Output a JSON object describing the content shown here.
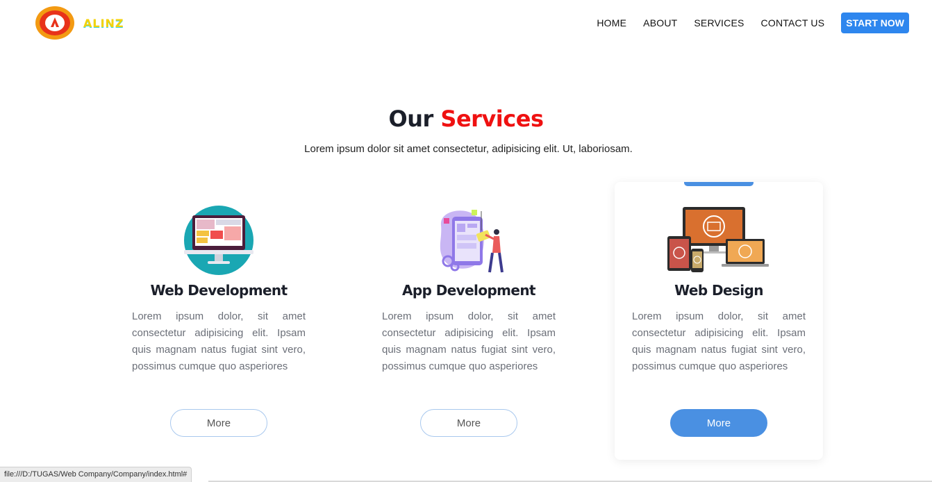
{
  "brand": {
    "name": "ALINZ"
  },
  "nav": {
    "links": [
      "HOME",
      "ABOUT",
      "SERVICES",
      "CONTACT US"
    ],
    "cta": "START NOW"
  },
  "section": {
    "title_dark": "Our",
    "title_red": "Services",
    "subtitle": "Lorem ipsum dolor sit amet consectetur, adipisicing elit. Ut, laboriosam."
  },
  "cards": [
    {
      "title": "Web Development",
      "text": "Lorem ipsum dolor, sit amet consectetur adipisicing elit. Ipsam quis magnam natus fugiat sint vero, possimus cumque quo asperiores",
      "button": "More",
      "icon": "web-development-illustration"
    },
    {
      "title": "App Development",
      "text": "Lorem ipsum dolor, sit amet consectetur adipisicing elit. Ipsam quis magnam natus fugiat sint vero, possimus cumque quo asperiores",
      "button": "More",
      "icon": "app-development-illustration"
    },
    {
      "title": "Web Design",
      "text": "Lorem ipsum dolor, sit amet consectetur adipisicing elit. Ipsam quis magnam natus fugiat sint vero, possimus cumque quo asperiores",
      "button": "More",
      "icon": "web-design-devices-illustration",
      "active": true
    }
  ],
  "status": {
    "url": "file:///D:/TUGAS/Web Company/Company/index.html#"
  },
  "colors": {
    "accent": "#4a90e2",
    "cta": "#2e86ee",
    "title_red": "#ef1111"
  }
}
